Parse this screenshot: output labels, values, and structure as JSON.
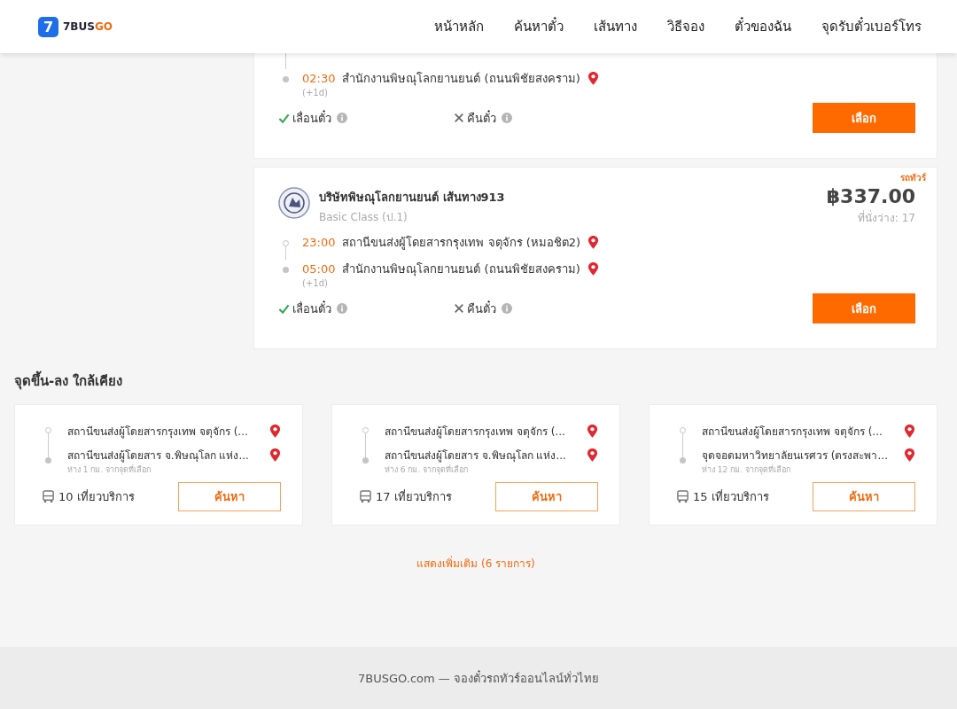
{
  "header": {
    "logo": {
      "mark": "7",
      "name": "7BUS",
      "accent": "GO"
    },
    "nav": [
      {
        "label": "หน้าหลัก"
      },
      {
        "label": "ค้นหาตั๋ว"
      },
      {
        "label": "เส้นทาง"
      },
      {
        "label": "วิธีจอง"
      },
      {
        "label": "ตั๋วของฉัน"
      },
      {
        "label": "จุดรับตั๋วเบอร์โทร"
      }
    ]
  },
  "trips": [
    {
      "stops": [
        {
          "kind": "arrival",
          "time": "02:30",
          "place": "สำนักงานพิษณุโลกยานยนต์ (ถนนพิชัยสงคราม)",
          "note": "(+1d)"
        }
      ],
      "continued": true,
      "features": [
        {
          "label": "เลื่อนตั๋ว",
          "available": true
        },
        {
          "label": "คืนตั๋ว",
          "available": false
        }
      ],
      "button": "เลือก"
    },
    {
      "badge": "รถทัวร์",
      "operator": "บริษัทพิษณุโลกยานยนต์ เส้นทาง913",
      "class": "Basic Class (ป.1)",
      "price": "฿337.00",
      "seats": "ที่นั่งว่าง: 17",
      "stops": [
        {
          "kind": "departure",
          "time": "23:00",
          "place": "สถานีขนส่งผู้โดยสารกรุงเทพ จตุจักร (หมอชิต2)"
        },
        {
          "kind": "arrival",
          "time": "05:00",
          "place": "สำนักงานพิษณุโลกยานยนต์ (ถนนพิชัยสงคราม)",
          "note": "(+1d)"
        }
      ],
      "features": [
        {
          "label": "เลื่อนตั๋ว",
          "available": true
        },
        {
          "label": "คืนตั๋ว",
          "available": false
        }
      ],
      "button": "เลือก"
    }
  ],
  "nearby": {
    "title": "จุดขึ้น-ลง ใกล้เคียง",
    "items": [
      {
        "from": "สถานีขนส่งผู้โดยสารกรุงเทพ จตุจักร (...",
        "to": "สถานีขนส่งผู้โดยสาร จ.พิษณุโลก แห่ง...",
        "distance": "ห่าง 1 กม. จากจุดที่เลือก",
        "trips": "10 เที่ยวบริการ",
        "button": "ค้นหา"
      },
      {
        "from": "สถานีขนส่งผู้โดยสารกรุงเทพ จตุจักร (...",
        "to": "สถานีขนส่งผู้โดยสาร จ.พิษณุโลก แห่ง...",
        "distance": "ห่าง 6 กม. จากจุดที่เลือก",
        "trips": "17 เที่ยวบริการ",
        "button": "ค้นหา"
      },
      {
        "from": "สถานีขนส่งผู้โดยสารกรุงเทพ จตุจักร (...",
        "to": "จุดจอดมหาวิทยาลัยนเรศวร (ตรงสะพา...",
        "distance": "ห่าง 12 กม. จากจุดที่เลือก",
        "trips": "15 เที่ยวบริการ",
        "button": "ค้นหา"
      }
    ],
    "more": "แสดงเพิ่มเติม (6 รายการ)"
  },
  "footer": "7BUSGO.com — จองตั๋วรถทัวร์ออนไลน์ทั่วไทย"
}
